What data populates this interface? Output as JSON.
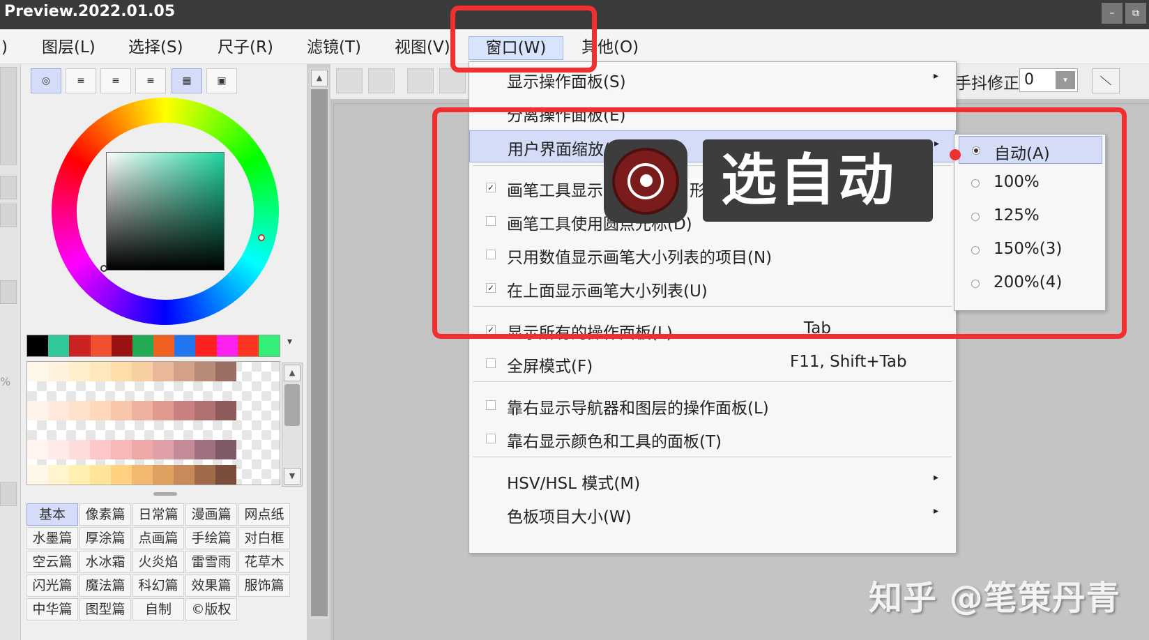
{
  "window": {
    "title": "Preview.2022.01.05",
    "min_label": "–",
    "restore_label": "⧉"
  },
  "menubar": {
    "prefix": ")",
    "items": [
      "图层(L)",
      "选择(S)",
      "尺子(R)",
      "滤镜(T)",
      "视图(V)",
      "窗口(W)",
      "其他(O)"
    ]
  },
  "stabilizer": {
    "label": "手抖修正",
    "value": "0"
  },
  "color_tabs": [
    "◎",
    "≡",
    "≡",
    "≡",
    "▦",
    "▣"
  ],
  "recent_colors": [
    "#000000",
    "#2ec89a",
    "#cc2222",
    "#f05030",
    "#991111",
    "#22aa55",
    "#f06020",
    "#2277ee",
    "#ff2020",
    "#ff22ee",
    "#ff3322",
    "#33ee77"
  ],
  "palette_rows": [
    [
      "#fff7ea",
      "#fff3dd",
      "#fff0cc",
      "#ffe8bb",
      "#ffddaa",
      "#f8cfa0",
      "#e8b898",
      "#d4a088",
      "#b88a78",
      "#9a6e62"
    ],
    [
      "#fff3ec",
      "#ffe9dd",
      "#ffe2cc",
      "#ffd7bb",
      "#f8c7aa",
      "#f0b2a0",
      "#e09a90",
      "#c88080",
      "#b06f70",
      "#8e5a5a"
    ],
    [
      "#fff4f0",
      "#ffeaea",
      "#ffdcdc",
      "#ffc8c8",
      "#f8b8b8",
      "#eea8a8",
      "#e0a0a8",
      "#c48a98",
      "#a07080",
      "#805a68"
    ],
    [
      "#fff8e8",
      "#fff4cc",
      "#fff0b0",
      "#ffe49a",
      "#ffd080",
      "#f2b870",
      "#e0a060",
      "#c88a58",
      "#a06a48",
      "#7a4e3a"
    ]
  ],
  "palette_groups": [
    "基本",
    "像素篇",
    "日常篇",
    "漫画篇",
    "网点纸",
    "水墨篇",
    "厚涂篇",
    "点画篇",
    "手绘篇",
    "对白框",
    "空云篇",
    "水冰霜",
    "火炎焰",
    "雷雪雨",
    "花草木",
    "闪光篇",
    "魔法篇",
    "科幻篇",
    "效果篇",
    "服饰篇",
    "中华篇",
    "图型篇",
    "自制",
    "©版权"
  ],
  "window_menu": {
    "items": [
      {
        "label": "显示操作面板(S)",
        "submenu": true
      },
      {
        "label": "分离操作面板(E)",
        "submenu": true
      },
      {
        "label": "用户界面缩放(",
        "submenu": true
      },
      {
        "label": "画笔工具显示",
        "suffix": "形(Z)",
        "checked": true
      },
      {
        "label": "画笔工具使用圆点光标(D)",
        "checked": false
      },
      {
        "label": "只用数值显示画笔大小列表的项目(N)",
        "checked": false
      },
      {
        "label": "在上面显示画笔大小列表(U)",
        "checked": true
      },
      {
        "label": "显示所有的操作面板(L)",
        "shortcut": "Tab",
        "checked": true
      },
      {
        "label": "全屏模式(F)",
        "shortcut": "F11, Shift+Tab",
        "checked": false
      },
      {
        "label": "靠右显示导航器和图层的操作面板(L)",
        "checked": false
      },
      {
        "label": "靠右显示颜色和工具的面板(T)",
        "checked": false
      },
      {
        "label": "HSV/HSL 模式(M)",
        "submenu": true
      },
      {
        "label": "色板项目大小(W)",
        "submenu": true
      }
    ]
  },
  "ui_scale_submenu": {
    "selected": "自动(A)",
    "options": [
      "自动(A)",
      "100%",
      "125%",
      "150%(3)",
      "200%(4)"
    ]
  },
  "annotation": {
    "callout_text": "选自动",
    "watermark": "知乎 @笔策丹青",
    "accent_color": "#f03030"
  },
  "left_strip_pct": "%",
  "glyphs": {
    "check": "✓",
    "submenu": "▸",
    "scroll_up": "▲",
    "scroll_down": "▼",
    "dropdown": "▾"
  }
}
